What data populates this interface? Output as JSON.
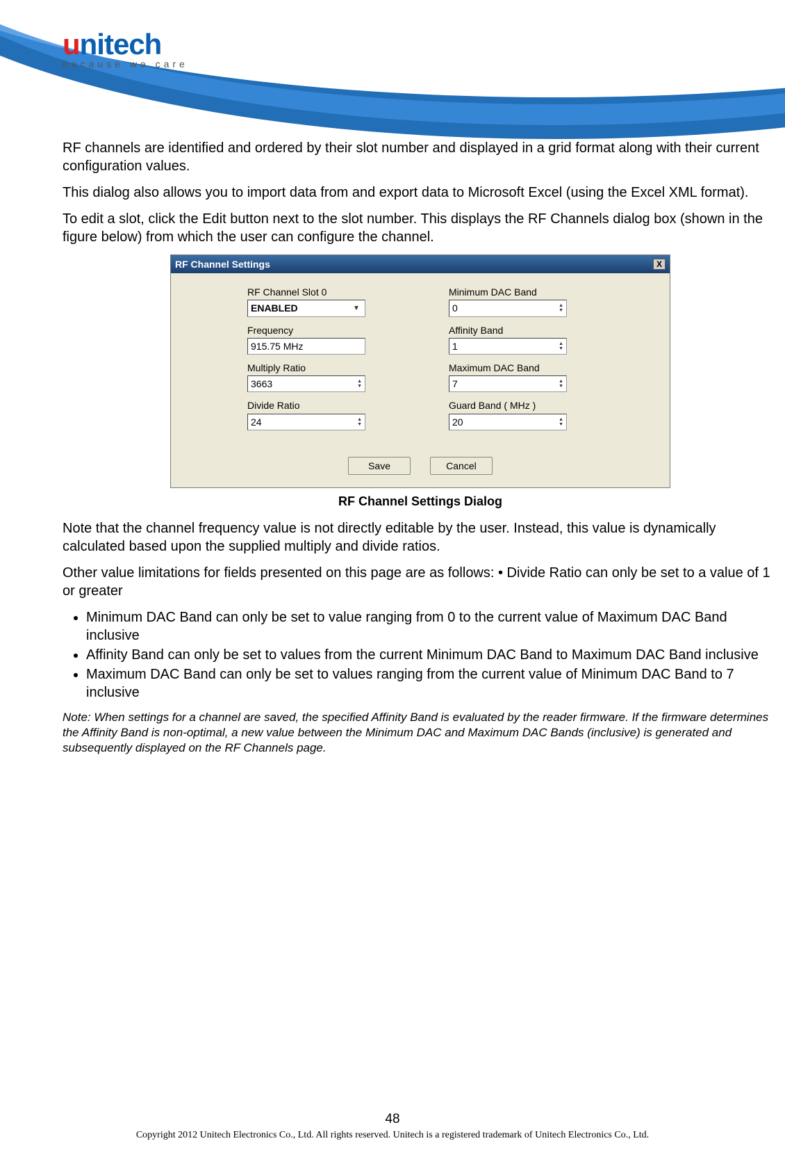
{
  "logo": {
    "brand_prefix": "u",
    "brand_rest": "nitech",
    "tagline": "because we care"
  },
  "body": {
    "p1": "RF channels are identified and ordered by their slot number and displayed in a grid format along with their current configuration values.",
    "p2": "This dialog also allows you to import data from and export data to Microsoft Excel (using the Excel XML format).",
    "p3": "To edit a slot, click the Edit button next to the slot number. This displays the RF Channels dialog box (shown in the figure below) from which the user can configure the channel.",
    "caption": "RF Channel Settings Dialog",
    "p4": "Note that the channel frequency value is not directly editable by the user. Instead, this value is dynamically calculated based upon the supplied multiply and divide ratios.",
    "p5": "Other value limitations for fields presented on this page are as follows: • Divide Ratio can only be set to a value of 1 or greater",
    "bullets": [
      "Minimum DAC Band can only be set to value ranging from 0 to the current value of Maximum DAC Band inclusive",
      "Affinity Band can only be set to values from the current Minimum DAC Band to Maximum DAC Band inclusive",
      "Maximum DAC Band can only be set to values ranging from the current value of Minimum DAC Band to 7 inclusive"
    ],
    "note": "Note: When settings for a channel are saved, the specified Affinity Band is evaluated by the reader firmware.  If the firmware determines the Affinity Band is non-optimal, a new value between the Minimum DAC and Maximum DAC Bands (inclusive) is generated and subsequently displayed on the RF Channels page."
  },
  "dialog": {
    "title": "RF Channel Settings",
    "close": "X",
    "left": {
      "slot_label": "RF Channel Slot 0",
      "slot_value": "ENABLED",
      "freq_label": "Frequency",
      "freq_value": "915.75 MHz",
      "mult_label": "Multiply Ratio",
      "mult_value": "3663",
      "div_label": "Divide Ratio",
      "div_value": "24"
    },
    "right": {
      "min_label": "Minimum DAC Band",
      "min_value": "0",
      "aff_label": "Affinity Band",
      "aff_value": "1",
      "max_label": "Maximum DAC Band",
      "max_value": "7",
      "guard_label": "Guard Band ( MHz )",
      "guard_value": "20"
    },
    "save": "Save",
    "cancel": "Cancel"
  },
  "footer": {
    "page": "48",
    "copyright": "Copyright 2012 Unitech Electronics Co., Ltd. All rights reserved. Unitech is a registered trademark of Unitech Electronics Co., Ltd."
  }
}
